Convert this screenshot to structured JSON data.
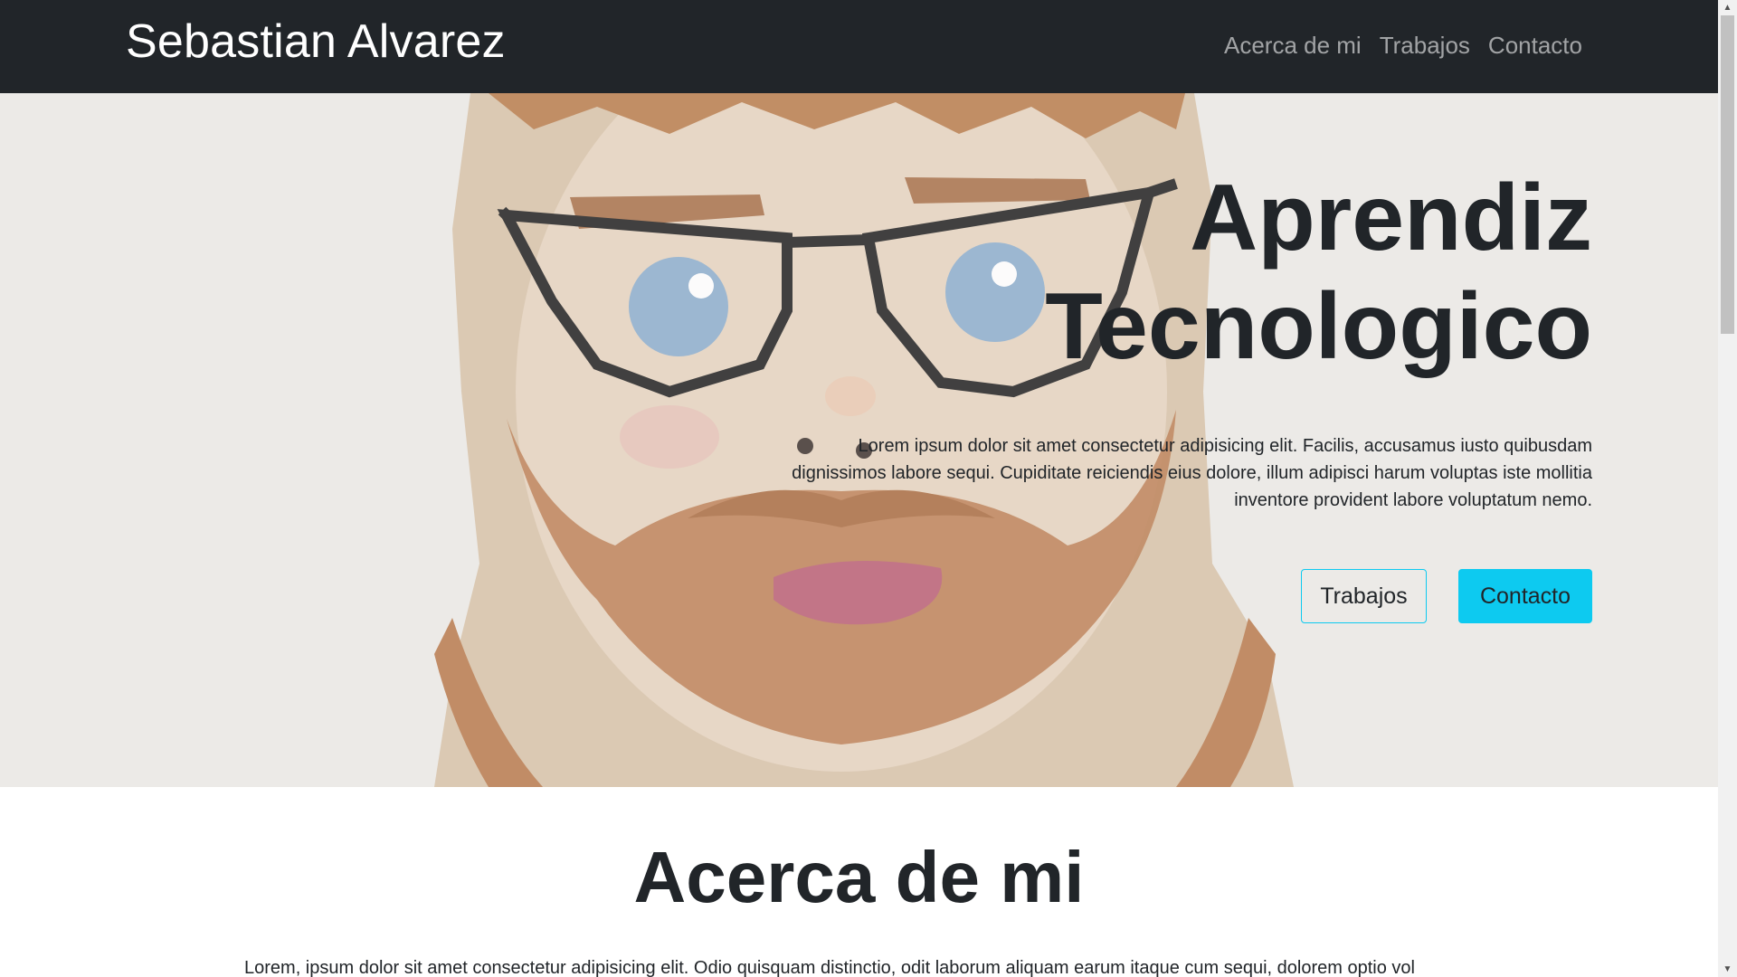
{
  "navbar": {
    "brand": "Sebastian Alvarez",
    "links": [
      "Acerca de mi",
      "Trabajos",
      "Contacto"
    ]
  },
  "hero": {
    "title_line1": "Aprendiz",
    "title_line2": "Tecnologico",
    "text_line1": "Lorem ipsum dolor sit amet consectetur adipisicing elit. Facilis, accusamus iusto quibusdam",
    "text_line2": "dignissimos labore sequi. Cupiditate reiciendis eius dolore, illum adipisci harum voluptas iste mollitia",
    "text_line3": "inventore provident labore voluptatum nemo.",
    "button_works": "Trabajos",
    "button_contact": "Contacto"
  },
  "about": {
    "title": "Acerca de mi",
    "text": "Lorem, ipsum dolor sit amet consectetur adipisicing elit. Odio quisquam distinctio, odit laborum aliquam earum itaque cum sequi, dolorem optio vol"
  },
  "colors": {
    "navbar_bg": "#212529",
    "accent": "#0dcaf0",
    "text": "#212529"
  },
  "icons": {
    "scroll_up": "triangle-up-icon",
    "scroll_down": "triangle-down-icon"
  }
}
